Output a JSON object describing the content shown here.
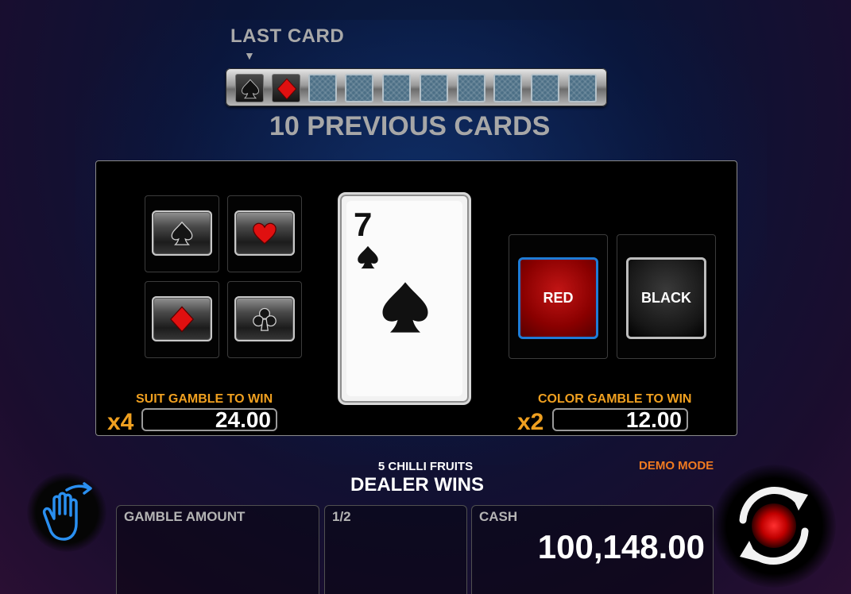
{
  "history": {
    "last_card_label": "LAST CARD",
    "previous_label": "10 PREVIOUS CARDS",
    "cards": [
      {
        "state": "faceup",
        "suit": "spade",
        "color": "#111111"
      },
      {
        "state": "faceup",
        "suit": "diamond",
        "color": "#e01010"
      },
      {
        "state": "back"
      },
      {
        "state": "back"
      },
      {
        "state": "back"
      },
      {
        "state": "back"
      },
      {
        "state": "back"
      },
      {
        "state": "back"
      },
      {
        "state": "back"
      },
      {
        "state": "back"
      }
    ]
  },
  "suit_buttons": [
    {
      "suit": "spade",
      "icon": "spade-icon"
    },
    {
      "suit": "heart",
      "icon": "heart-icon"
    },
    {
      "suit": "diamond",
      "icon": "diamond-icon"
    },
    {
      "suit": "club",
      "icon": "club-icon"
    }
  ],
  "current_card": {
    "rank": "7",
    "suit": "spade"
  },
  "color_buttons": {
    "red_label": "RED",
    "black_label": "BLACK"
  },
  "suit_gamble": {
    "label": "SUIT GAMBLE TO WIN",
    "multiplier": "x4",
    "amount": "24.00"
  },
  "color_gamble": {
    "label": "COLOR GAMBLE TO WIN",
    "multiplier": "x2",
    "amount": "12.00"
  },
  "status": {
    "game_name": "5 CHILLI FRUITS",
    "message": "DEALER WINS",
    "mode": "DEMO MODE"
  },
  "info": {
    "gamble_amount_label": "GAMBLE AMOUNT",
    "gamble_amount_value": "",
    "step_label": "1/2",
    "cash_label": "CASH",
    "cash_value": "100,148.00"
  },
  "colors": {
    "accent_orange": "#f0a020",
    "demo_orange": "#f07a20",
    "red": "#e01010",
    "selection_blue": "#1f7cd6"
  }
}
